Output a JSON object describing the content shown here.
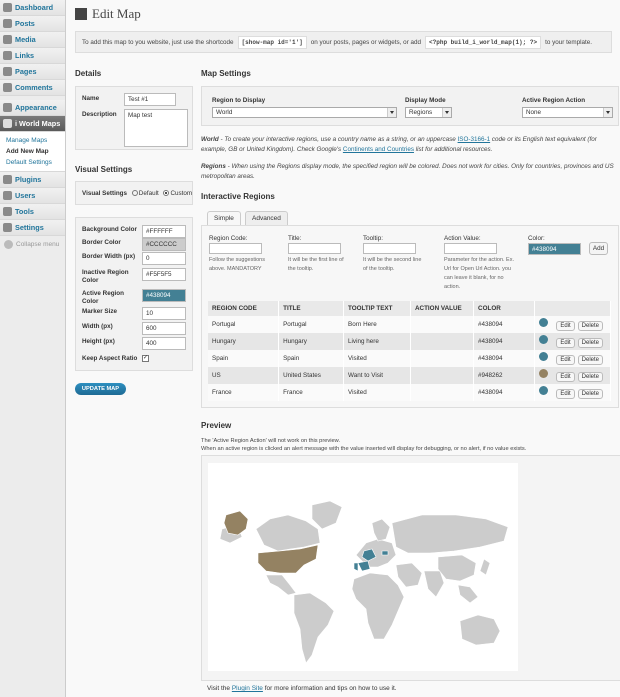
{
  "sidebar": {
    "items": [
      {
        "label": "Dashboard",
        "icon": "dashboard-icon"
      },
      {
        "label": "Posts",
        "icon": "posts-icon"
      },
      {
        "label": "Media",
        "icon": "media-icon"
      },
      {
        "label": "Links",
        "icon": "links-icon"
      },
      {
        "label": "Pages",
        "icon": "pages-icon"
      },
      {
        "label": "Comments",
        "icon": "comments-icon"
      },
      {
        "label": "Appearance",
        "icon": "appearance-icon"
      },
      {
        "label": "i World Maps",
        "icon": "world-maps-icon"
      },
      {
        "label": "Plugins",
        "icon": "plugins-icon"
      },
      {
        "label": "Users",
        "icon": "users-icon"
      },
      {
        "label": "Tools",
        "icon": "tools-icon"
      },
      {
        "label": "Settings",
        "icon": "settings-icon"
      }
    ],
    "submenu": [
      "Manage Maps",
      "Add New Map",
      "Default Settings"
    ],
    "collapse": "Collapse menu"
  },
  "page": {
    "title": "Edit Map",
    "notice_pre": "To add this map to you website, just use the shortcode",
    "notice_code1": "[show-map id='1']",
    "notice_mid": "on your posts, pages or widgets, or add",
    "notice_code2": "<?php build_i_world_map(1); ?>",
    "notice_post": "to your template."
  },
  "details": {
    "heading": "Details",
    "name_label": "Name",
    "name_value": "Test #1",
    "desc_label": "Description",
    "desc_value": "Map test"
  },
  "visual": {
    "heading": "Visual Settings",
    "label": "Visual Settings",
    "opt_default": "Default",
    "opt_custom": "Custom",
    "fields": [
      {
        "label": "Background Color",
        "value": "#FFFFFF"
      },
      {
        "label": "Border Color",
        "value": "#CCCCCC"
      },
      {
        "label": "Border Width (px)",
        "value": "0"
      },
      {
        "label": "Inactive Region Color",
        "value": "#F5F5F5"
      },
      {
        "label": "Active Region Color",
        "value": "#438094"
      },
      {
        "label": "Marker Size",
        "value": "10"
      },
      {
        "label": "Width (px)",
        "value": "600"
      },
      {
        "label": "Height (px)",
        "value": "400"
      }
    ],
    "aspect_label": "Keep Aspect Ratio",
    "update_button": "UPDATE MAP"
  },
  "map_settings": {
    "heading": "Map Settings",
    "region_label": "Region to Display",
    "region_value": "World",
    "mode_label": "Display Mode",
    "mode_value": "Regions",
    "action_label": "Active Region Action",
    "action_value": "None",
    "desc1_em": "World",
    "desc1_a": "- To create your interactive regions, use a country name as a string, or an uppercase",
    "desc1_link": "ISO-3166-1",
    "desc1_b": "code or its English text equivalent (for example, GB or United Kingdom). Check Google's",
    "desc1_link2": "Continents and Countries",
    "desc1_c": "list for additional resources.",
    "desc2_em": "Regions",
    "desc2": "- When using the Regions display mode, the specified region will be colored. Does not work for cities. Only for countries, provinces and US metropolitan areas."
  },
  "regions": {
    "heading": "Interactive Regions",
    "tab_simple": "Simple",
    "tab_advanced": "Advanced",
    "code_label": "Region Code:",
    "code_note": "Follow the suggestions above. MANDATORY",
    "title_label": "Title:",
    "title_note": "It will be the first line of the tooltip.",
    "tooltip_label": "Tooltip:",
    "tooltip_note": "It will be the second line of the tooltip.",
    "action_label": "Action Value:",
    "action_note": "Parameter for the action. Ex. Url for Open Url Action. you can leave it blank, for no action.",
    "color_label": "Color:",
    "color_value": "#438094",
    "add_button": "Add",
    "columns": [
      "REGION CODE",
      "TITLE",
      "TOOLTIP TEXT",
      "ACTION VALUE",
      "COLOR"
    ],
    "edit_label": "Edit",
    "delete_label": "Delete",
    "rows": [
      {
        "code": "Portugal",
        "title": "Portugal",
        "tooltip": "Born Here",
        "action": "",
        "color": "#438094"
      },
      {
        "code": "Hungary",
        "title": "Hungary",
        "tooltip": "Living here",
        "action": "",
        "color": "#438094"
      },
      {
        "code": "Spain",
        "title": "Spain",
        "tooltip": "Visited",
        "action": "",
        "color": "#438094"
      },
      {
        "code": "US",
        "title": "United States",
        "tooltip": "Want to Visit",
        "action": "",
        "color": "#948262"
      },
      {
        "code": "France",
        "title": "France",
        "tooltip": "Visited",
        "action": "",
        "color": "#438094"
      }
    ]
  },
  "preview": {
    "heading": "Preview",
    "note1": "The 'Active Region Action' will not work on this preview.",
    "note2": "When an active region is clicked an alert message with the value inserted will display for debugging, or no alert, if no value exists.",
    "inactive_color": "#cccccc",
    "active_color": "#438094",
    "us_color": "#948262"
  },
  "footer": {
    "pre": "Visit the",
    "link": "Plugin Site",
    "post": "for more information and tips on how to use it."
  }
}
